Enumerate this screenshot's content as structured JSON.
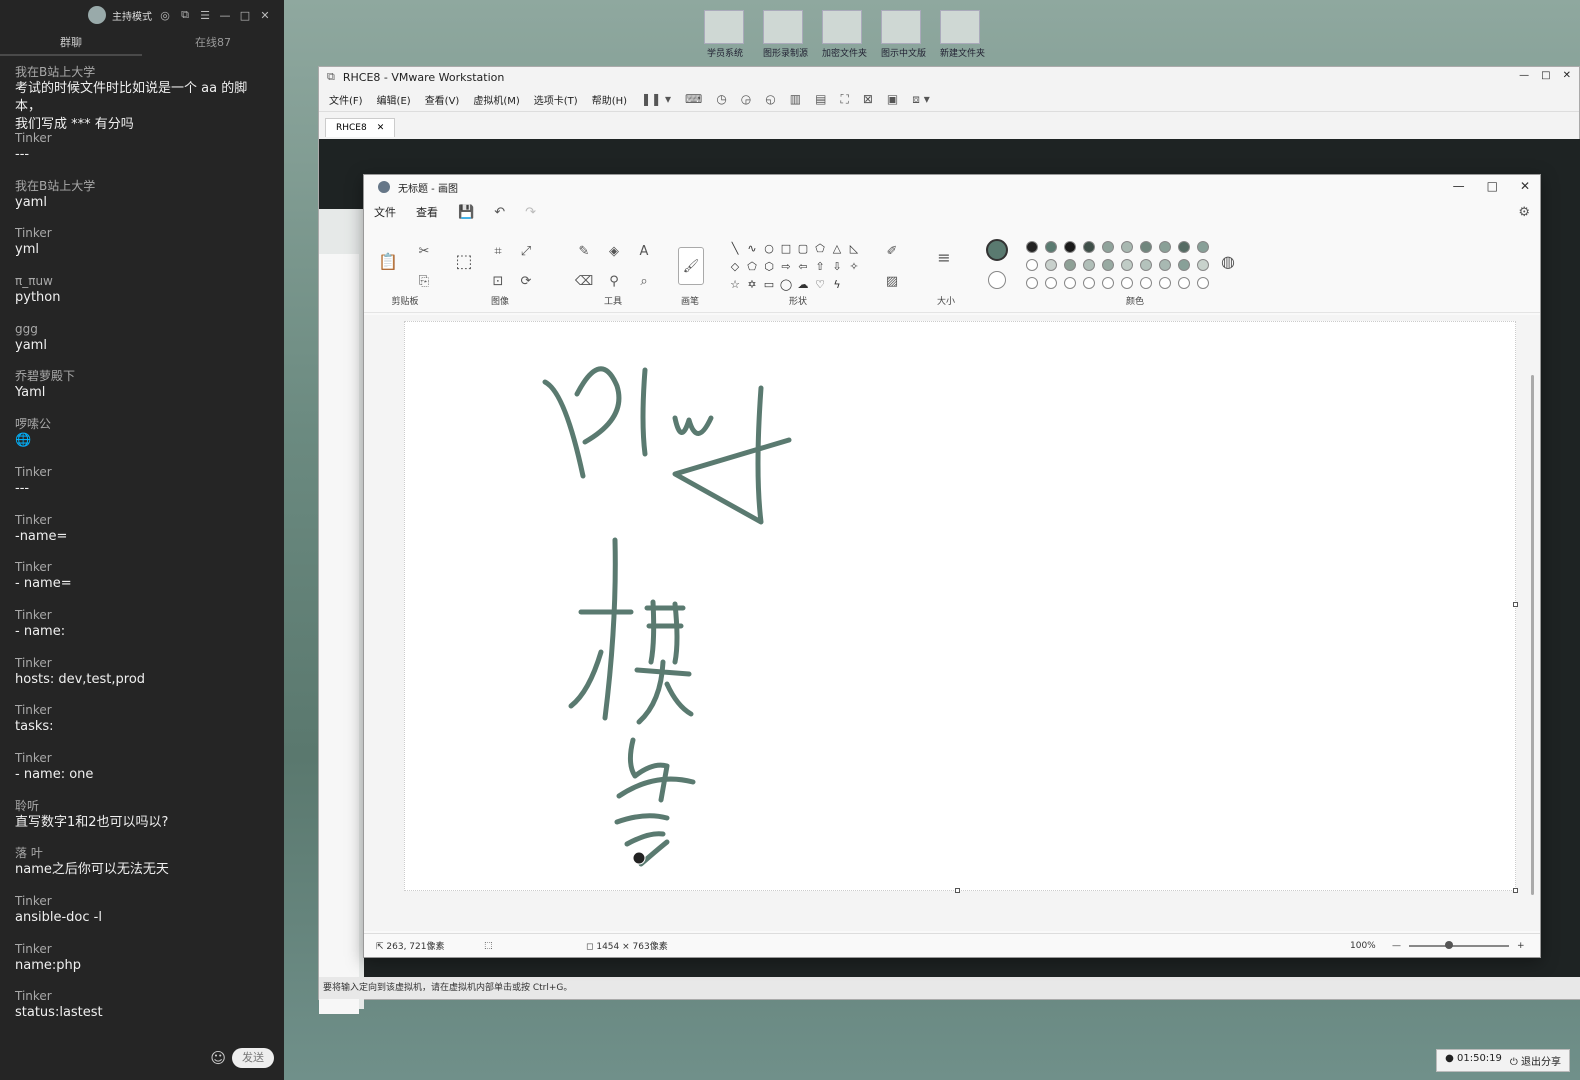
{
  "chat": {
    "header": {
      "mode_label": "主持模式"
    },
    "tabs": [
      {
        "label": "群聊"
      },
      {
        "label": "在线87"
      }
    ],
    "messages": [
      {
        "name": "我在B站上大学",
        "text": "考试的时候文件时比如说是一个 aa 的脚本，\n我们写成 *** 有分吗"
      },
      {
        "name": "Tinker",
        "text": "---"
      },
      {
        "name": "我在B站上大学",
        "text": "yaml"
      },
      {
        "name": "Tinker",
        "text": "yml"
      },
      {
        "name": "π_πuw",
        "text": "python"
      },
      {
        "name": "ggg",
        "text": "yaml"
      },
      {
        "name": "乔碧萝殿下",
        "text": "Yaml"
      },
      {
        "name": "啰嗦公",
        "text": "🌐"
      },
      {
        "name": "Tinker",
        "text": "---"
      },
      {
        "name": "Tinker",
        "text": "-name="
      },
      {
        "name": "Tinker",
        "text": "- name="
      },
      {
        "name": "Tinker",
        "text": "- name:"
      },
      {
        "name": "Tinker",
        "text": "hosts: dev,test,prod"
      },
      {
        "name": "Tinker",
        "text": "tasks:"
      },
      {
        "name": "Tinker",
        "text": "- name: one"
      },
      {
        "name": "聆听",
        "text": "直写数字1和2也可以吗以?"
      },
      {
        "name": "落 叶",
        "text": "name之后你可以无法无天"
      },
      {
        "name": "Tinker",
        "text": "ansible-doc -l"
      },
      {
        "name": "Tinker",
        "text": "name:php"
      },
      {
        "name": "Tinker",
        "text": "status:lastest"
      }
    ],
    "send_label": "发送"
  },
  "desktop": {
    "icons": [
      {
        "label": "学员系统",
        "icon": "folder-icon"
      },
      {
        "label": "图形录制源",
        "icon": "folder-icon"
      },
      {
        "label": "加密文件夹",
        "icon": "folder-icon"
      },
      {
        "label": "图示中文版",
        "icon": "folder-icon"
      },
      {
        "label": "新建文件夹",
        "icon": "folder-icon"
      }
    ]
  },
  "vmware": {
    "title": "RHCE8 - VMware Workstation",
    "menu": [
      "文件(F)",
      "编辑(E)",
      "查看(V)",
      "虚拟机(M)",
      "选项卡(T)",
      "帮助(H)"
    ],
    "tab_label": "RHCE8",
    "status_text": "要将输入定向到该虚拟机，请在虚拟机内部单击或按 Ctrl+G。"
  },
  "paint": {
    "title": "无标题 - 画图",
    "menu": [
      "文件",
      "查看"
    ],
    "groups": {
      "clipboard": "剪贴板",
      "image": "图像",
      "tools": "工具",
      "brushes": "画笔",
      "shapes": "形状",
      "size": "大小",
      "colors": "颜色"
    },
    "status": {
      "position": "263, 721像素",
      "size": "1454 × 763像素",
      "zoom": "100%"
    },
    "colors": {
      "stroke": "#5a7a70",
      "primary": "#5a7a70",
      "swatch_row1": [
        "#222222",
        "#5a7a70",
        "#1a1a1a",
        "#3f4f49",
        "#8fa39b",
        "#a8b8b1",
        "#70867d",
        "#8aa097",
        "#556b63",
        "#88a098"
      ],
      "swatch_row2": [
        "#ffffff",
        "#c8d0cc",
        "#8ea096",
        "#b0beb8",
        "#98aaa2",
        "#c0ccc6",
        "#b4c2bc",
        "#a8b8b2",
        "#88a098",
        "#c8d2cc"
      ]
    }
  },
  "taskbar": {
    "timer": "01:50:19",
    "exit_share": "退出分享"
  }
}
